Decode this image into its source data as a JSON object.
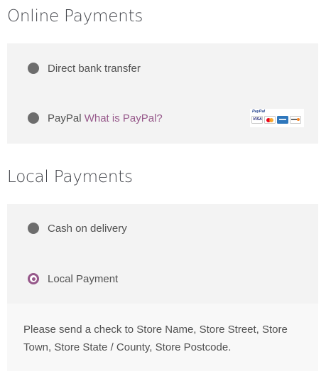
{
  "online_payments": {
    "title": "Online Payments",
    "methods": [
      {
        "label": "Direct bank transfer",
        "selected": false
      },
      {
        "label": "PayPal",
        "link_text": "What is PayPal?",
        "selected": false,
        "icon": "paypal-acceptance-mark"
      }
    ],
    "paypal_logo": {
      "mark_text": "PayPal",
      "card_text": "VISA"
    }
  },
  "local_payments": {
    "title": "Local Payments",
    "methods": [
      {
        "label": "Cash on delivery",
        "selected": false
      },
      {
        "label": "Local Payment",
        "selected": true
      }
    ],
    "selected_description": "Please send a check to Store Name, Store Street, Store Town, Store State / County, Store Postcode."
  },
  "colors": {
    "accent": "#96588a",
    "panel_bg": "#f3f3f3",
    "description_bg": "#f8f8f8",
    "radio_unchecked": "#6d6d6d"
  }
}
